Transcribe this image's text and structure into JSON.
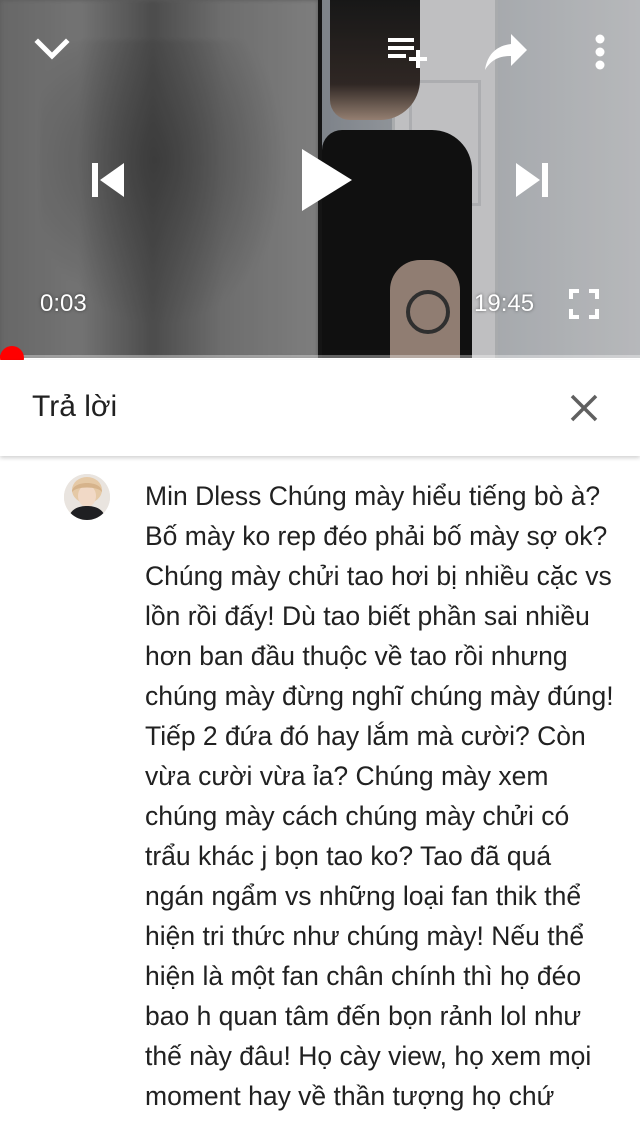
{
  "player": {
    "current_time": "0:03",
    "duration": "19:45",
    "progress_fraction": 0.0025,
    "accent_color": "#ff0000",
    "icons": {
      "minimize": "chevron-down-icon",
      "add_to_playlist": "playlist-add-icon",
      "share": "share-icon",
      "more": "more-vert-icon",
      "previous": "skip-previous-icon",
      "play": "play-icon",
      "next": "skip-next-icon",
      "fullscreen": "fullscreen-icon"
    }
  },
  "reply_panel": {
    "title": "Trả lời",
    "close_icon": "close-icon"
  },
  "comment": {
    "text": "Min Dless Chúng mày hiểu tiếng bò à? Bố mày ko rep đéo phải bố mày sợ ok? Chúng mày chửi tao hơi bị nhiều cặc vs lồn rồi đấy! Dù tao biết phần sai nhiều hơn ban đầu thuộc về tao rồi nhưng chúng mày đừng nghĩ chúng mày đúng! Tiếp 2 đứa đó hay lắm mà cười? Còn vừa cười vừa ỉa? Chúng mày xem chúng mày cách chúng mày chửi có trẩu khác j bọn tao ko? Tao đã quá ngán ngẩm vs những loại fan thik thể hiện tri thức như chúng mày! Nếu thể hiện là một fan chân chính thì họ đéo bao h quan tâm đến bọn rảnh lol như thế này đâu! Họ cày view, họ xem mọi moment hay về thần tượng họ chứ"
  }
}
